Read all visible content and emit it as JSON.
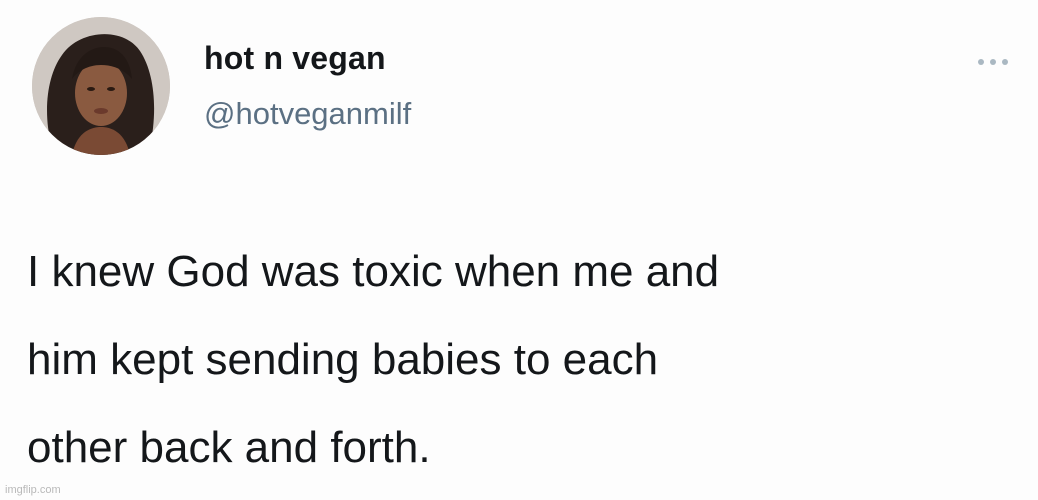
{
  "tweet": {
    "author": {
      "display_name": "hot n vegan",
      "handle": "@hotveganmilf"
    },
    "text_lines": [
      "I knew God was toxic when me and",
      "him kept sending babies to each",
      "other back and forth."
    ],
    "more_icon": "ellipsis-icon"
  },
  "watermark": "imgflip.com"
}
